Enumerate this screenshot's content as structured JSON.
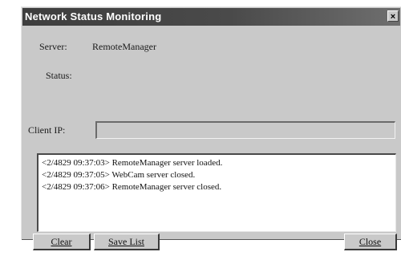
{
  "window": {
    "title": "Network Status Monitoring",
    "close_glyph": "×"
  },
  "server": {
    "label": "Server:",
    "value": "RemoteManager"
  },
  "status": {
    "label": "Status:",
    "value": ""
  },
  "client_ip": {
    "label": "Client IP:",
    "value": ""
  },
  "log": {
    "lines": [
      "<2/4829 09:37:03> RemoteManager server loaded.",
      "<2/4829 09:37:05> WebCam server closed.",
      "<2/4829 09:37:06> RemoteManager server closed."
    ]
  },
  "buttons": {
    "clear": "Clear",
    "save_list": "Save List",
    "close": "Close"
  }
}
